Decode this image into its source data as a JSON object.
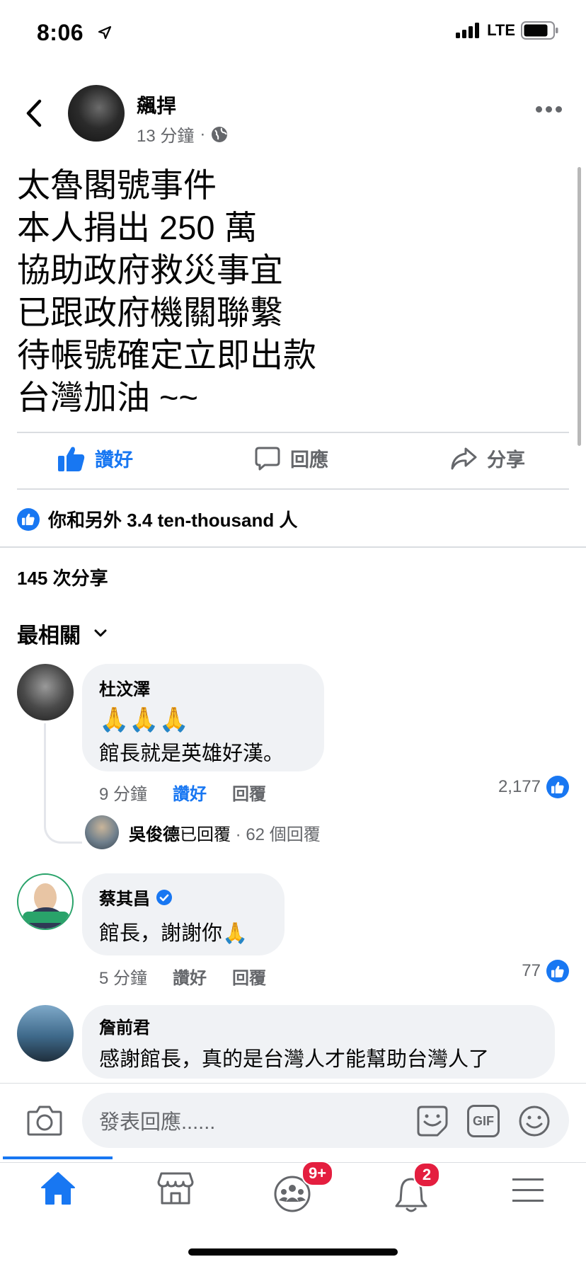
{
  "status_bar": {
    "time": "8:06",
    "network": "LTE"
  },
  "post": {
    "author": "飆捍",
    "time": "13 分鐘",
    "lines": [
      "太魯閣號事件",
      "本人捐出 250 萬",
      "協助政府救災事宜",
      "已跟政府機關聯繫",
      "待帳號確定立即出款",
      "台灣加油 ~~"
    ],
    "actions": {
      "like": "讚好",
      "comment": "回應",
      "share": "分享"
    },
    "reactions_text": "你和另外 3.4 ten-thousand 人",
    "shares_text": "145 次分享",
    "sort_label": "最相關"
  },
  "comments": [
    {
      "name": "杜汶澤",
      "emoji": "🙏🙏🙏",
      "text": "館長就是英雄好漢。",
      "time": "9 分鐘",
      "like_label": "讚好",
      "reply_label": "回覆",
      "likes": "2,177",
      "liked": true,
      "reply_summary": {
        "name": "吳俊德",
        "action": "已回覆",
        "count": "· 62 個回覆"
      }
    },
    {
      "name": "蔡其昌",
      "verified": true,
      "text": "館長，謝謝你🙏",
      "time": "5 分鐘",
      "like_label": "讚好",
      "reply_label": "回覆",
      "likes": "77",
      "liked": false
    },
    {
      "name": "詹前君",
      "text": "感謝館長，真的是台灣人才能幫助台灣人了"
    }
  ],
  "composer": {
    "placeholder": "發表回應......",
    "gif_label": "GIF"
  },
  "tabbar": {
    "tabs": [
      "home-icon",
      "marketplace-icon",
      "groups-icon",
      "notifications-icon",
      "menu-icon"
    ],
    "groups_badge": "9+",
    "notifications_badge": "2"
  },
  "colors": {
    "accent": "#1877f2",
    "badge": "#e41e3f",
    "secondary_text": "#65676b",
    "bubble": "#f0f2f5"
  }
}
